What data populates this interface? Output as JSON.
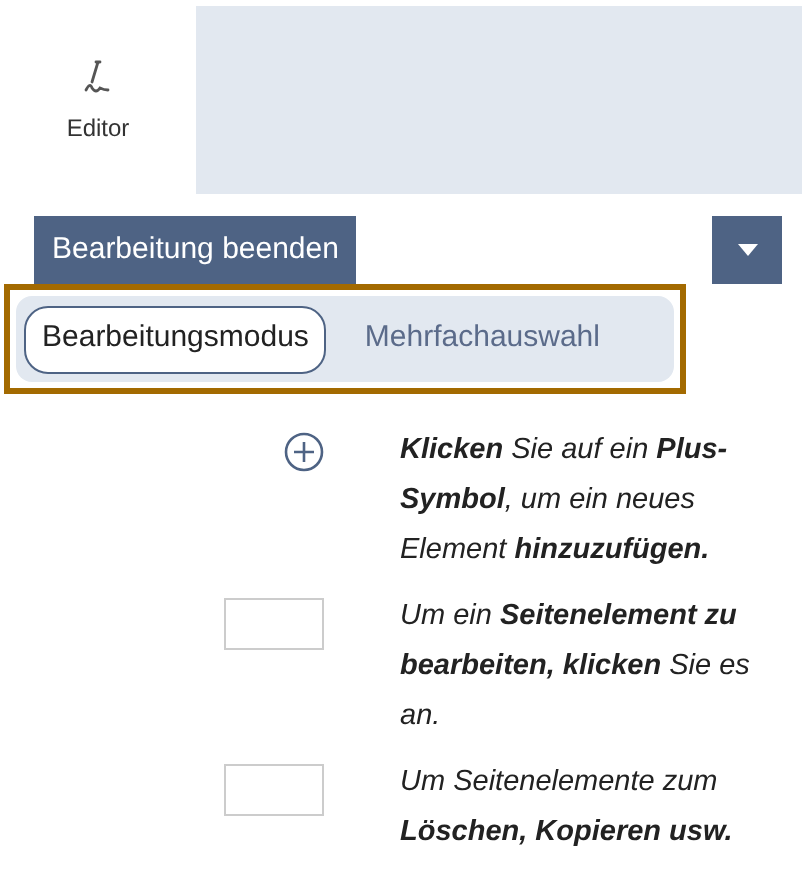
{
  "sidebar": {
    "label": "Editor"
  },
  "primary_button": {
    "label": "Bearbeitung beenden"
  },
  "mode_tabs": [
    {
      "label": "Bearbeitungsmodus",
      "selected": true
    },
    {
      "label": "Mehrfachauswahl",
      "selected": false
    }
  ],
  "instructions": [
    {
      "kind": "plus",
      "text": "**Klicken** Sie auf ein **Plus-Symbol**, um ein neues Element **hinzuzufügen.**"
    },
    {
      "kind": "box",
      "text": "Um ein **Seitenelement zu bearbeiten, klicken** Sie es an."
    },
    {
      "kind": "box",
      "text": "Um Seitenelemente zum **Löschen, Kopieren usw.**"
    }
  ]
}
